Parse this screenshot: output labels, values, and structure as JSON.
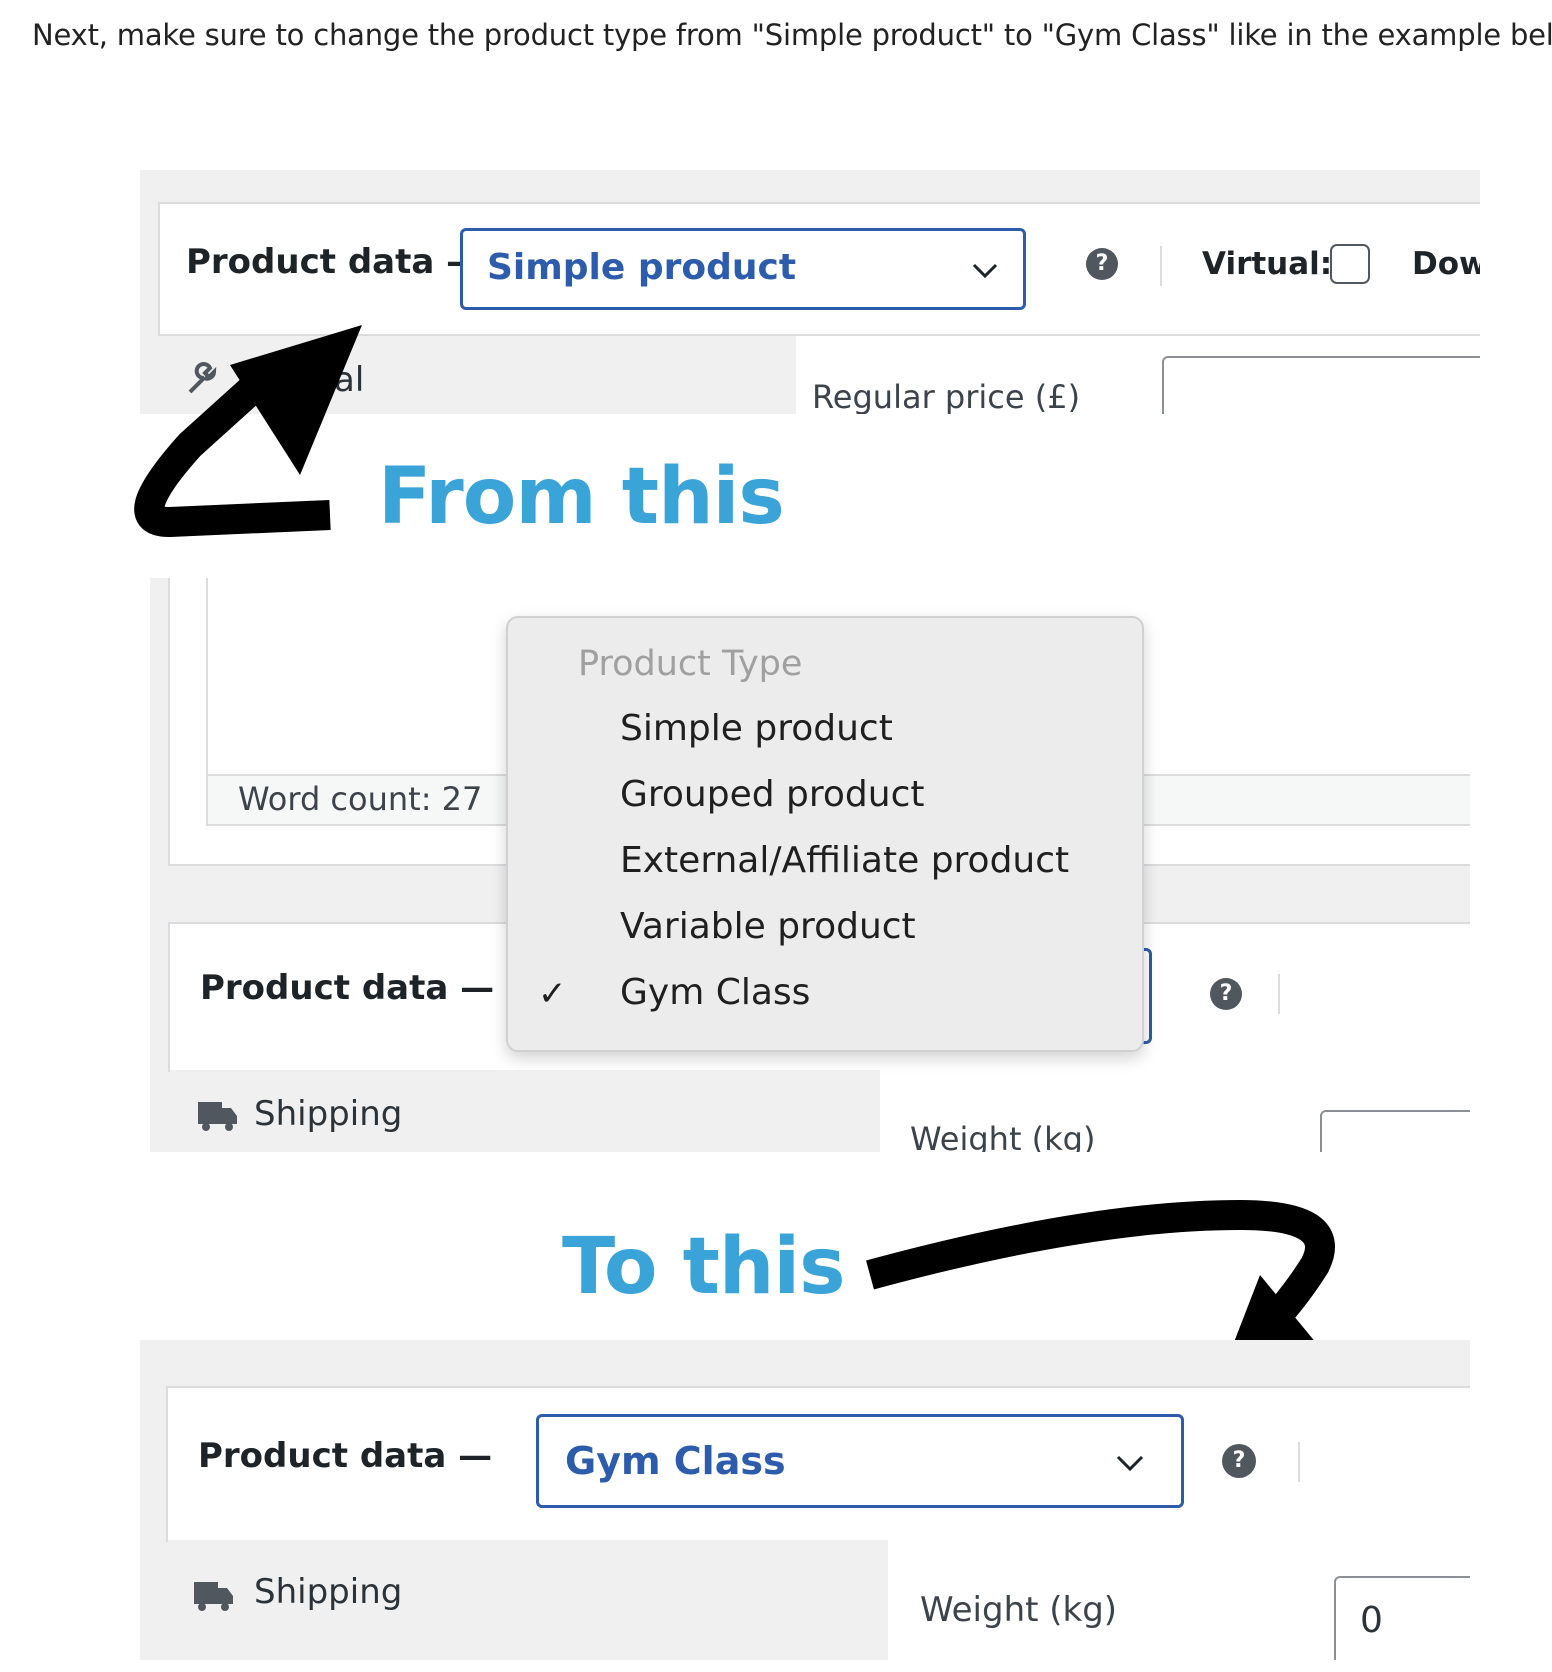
{
  "intro_text": "Next, make sure to change the product type from \"Simple product\" to \"Gym Class\" like in the example below.",
  "captions": {
    "from": "From this",
    "to": "To this"
  },
  "before": {
    "header_label": "Product data —",
    "select_value": "Simple product",
    "help": "?",
    "virtual_label": "Virtual:",
    "downloadable_label": "Down",
    "tab_general": "al",
    "regular_price_label": "Regular price (£)"
  },
  "dropdown": {
    "word_count": "Word count: 27",
    "header_label": "Product data —",
    "help": "?",
    "menu_title": "Product Type",
    "options": [
      "Simple product",
      "Grouped product",
      "External/Affiliate product",
      "Variable product",
      "Gym Class"
    ],
    "selected_mark": "✓",
    "tab_shipping": "Shipping",
    "weight_label": "Weight (kg)"
  },
  "after": {
    "header_label": "Product data —",
    "select_value": "Gym Class",
    "help": "?",
    "tab_shipping": "Shipping",
    "weight_label": "Weight (kg)",
    "weight_value": "0"
  },
  "colors": {
    "accent": "#2c5cab",
    "caption": "#3aa3d8",
    "arrow": "#000000"
  },
  "icons": [
    "chevron-down-icon",
    "help-icon",
    "wrench-icon",
    "truck-icon",
    "checkmark-icon",
    "curved-arrow"
  ]
}
